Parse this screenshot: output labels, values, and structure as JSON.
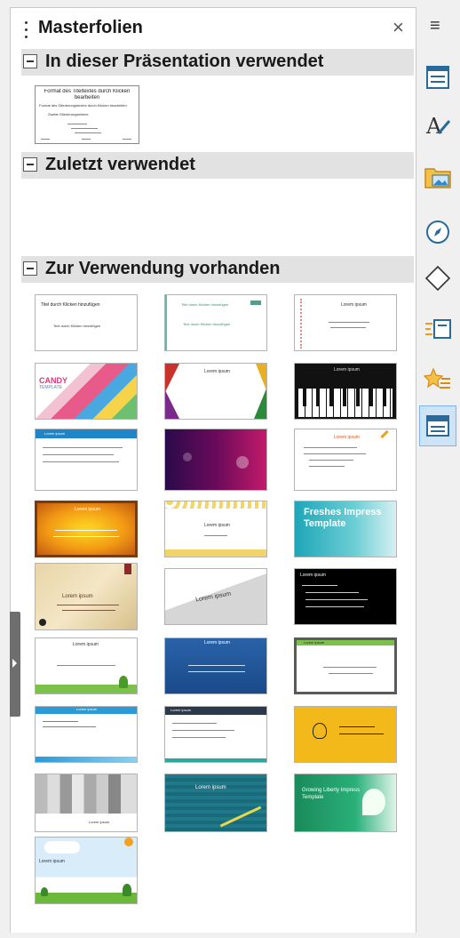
{
  "panel": {
    "title": "Masterfolien",
    "close_glyph": "×",
    "menu_glyph": "≡"
  },
  "sections": [
    {
      "label": "In dieser Präsentation verwendet"
    },
    {
      "label": "Zuletzt verwendet"
    },
    {
      "label": "Zur Verwendung vorhanden"
    }
  ],
  "used_master": {
    "title": "Format des Titeltextes durch Klicken bearbeiten",
    "bullets": [
      "Format des Gliederungstextes durch Klicken bearbeiten",
      "Zweite Gliederungsebene"
    ]
  },
  "available_masters": [
    {
      "text": "Titel durch Klicken hinzufügen",
      "sub": "Text durch Klicken hinzufügen"
    },
    {
      "text": "Titel durch Klicken hinzufügen",
      "sub": "Text durch Klicken hinzufügen"
    },
    {
      "text": "Lorem ipsum",
      "sub": ""
    },
    {
      "text": "CANDY",
      "sub": "TEMPLATE"
    },
    {
      "text": "Lorem ipsum",
      "sub": ""
    },
    {
      "text": "Lorem ipsum",
      "sub": ""
    },
    {
      "text": "Lorem ipsum",
      "sub": ""
    },
    {
      "text": "",
      "sub": ""
    },
    {
      "text": "Lorem ipsum",
      "sub": ""
    },
    {
      "text": "Lorem ipsum",
      "sub": ""
    },
    {
      "text": "Lorem ipsum",
      "sub": ""
    },
    {
      "text": "Freshes Impress Template",
      "sub": ""
    },
    {
      "text": "Lorem ipsum",
      "sub": ""
    },
    {
      "text": "Lorem ipsum",
      "sub": ""
    },
    {
      "text": "Lorem ipsum",
      "sub": ""
    },
    {
      "text": "Lorem ipsum",
      "sub": ""
    },
    {
      "text": "Lorem ipsum",
      "sub": ""
    },
    {
      "text": "Lorem ipsum",
      "sub": ""
    },
    {
      "text": "Lorem ipsum",
      "sub": ""
    },
    {
      "text": "Lorem ipsum",
      "sub": ""
    },
    {
      "text": "",
      "sub": ""
    },
    {
      "text": "Lorem ipsum",
      "sub": ""
    },
    {
      "text": "Lorem ipsum",
      "sub": ""
    },
    {
      "text": "Growing Liberty Impress Template",
      "sub": ""
    },
    {
      "text": "Lorem ipsum",
      "sub": ""
    }
  ],
  "sidebar_icons": [
    {
      "name": "properties-icon"
    },
    {
      "name": "styles-icon"
    },
    {
      "name": "gallery-icon"
    },
    {
      "name": "navigator-icon"
    },
    {
      "name": "shapes-icon"
    },
    {
      "name": "slide-transition-icon"
    },
    {
      "name": "animation-icon"
    },
    {
      "name": "master-slides-icon",
      "active": true
    }
  ],
  "colors": {
    "accent": "#7eb4ea",
    "active_bg": "#cfe3f7",
    "section_bg": "#e2e2e2"
  }
}
